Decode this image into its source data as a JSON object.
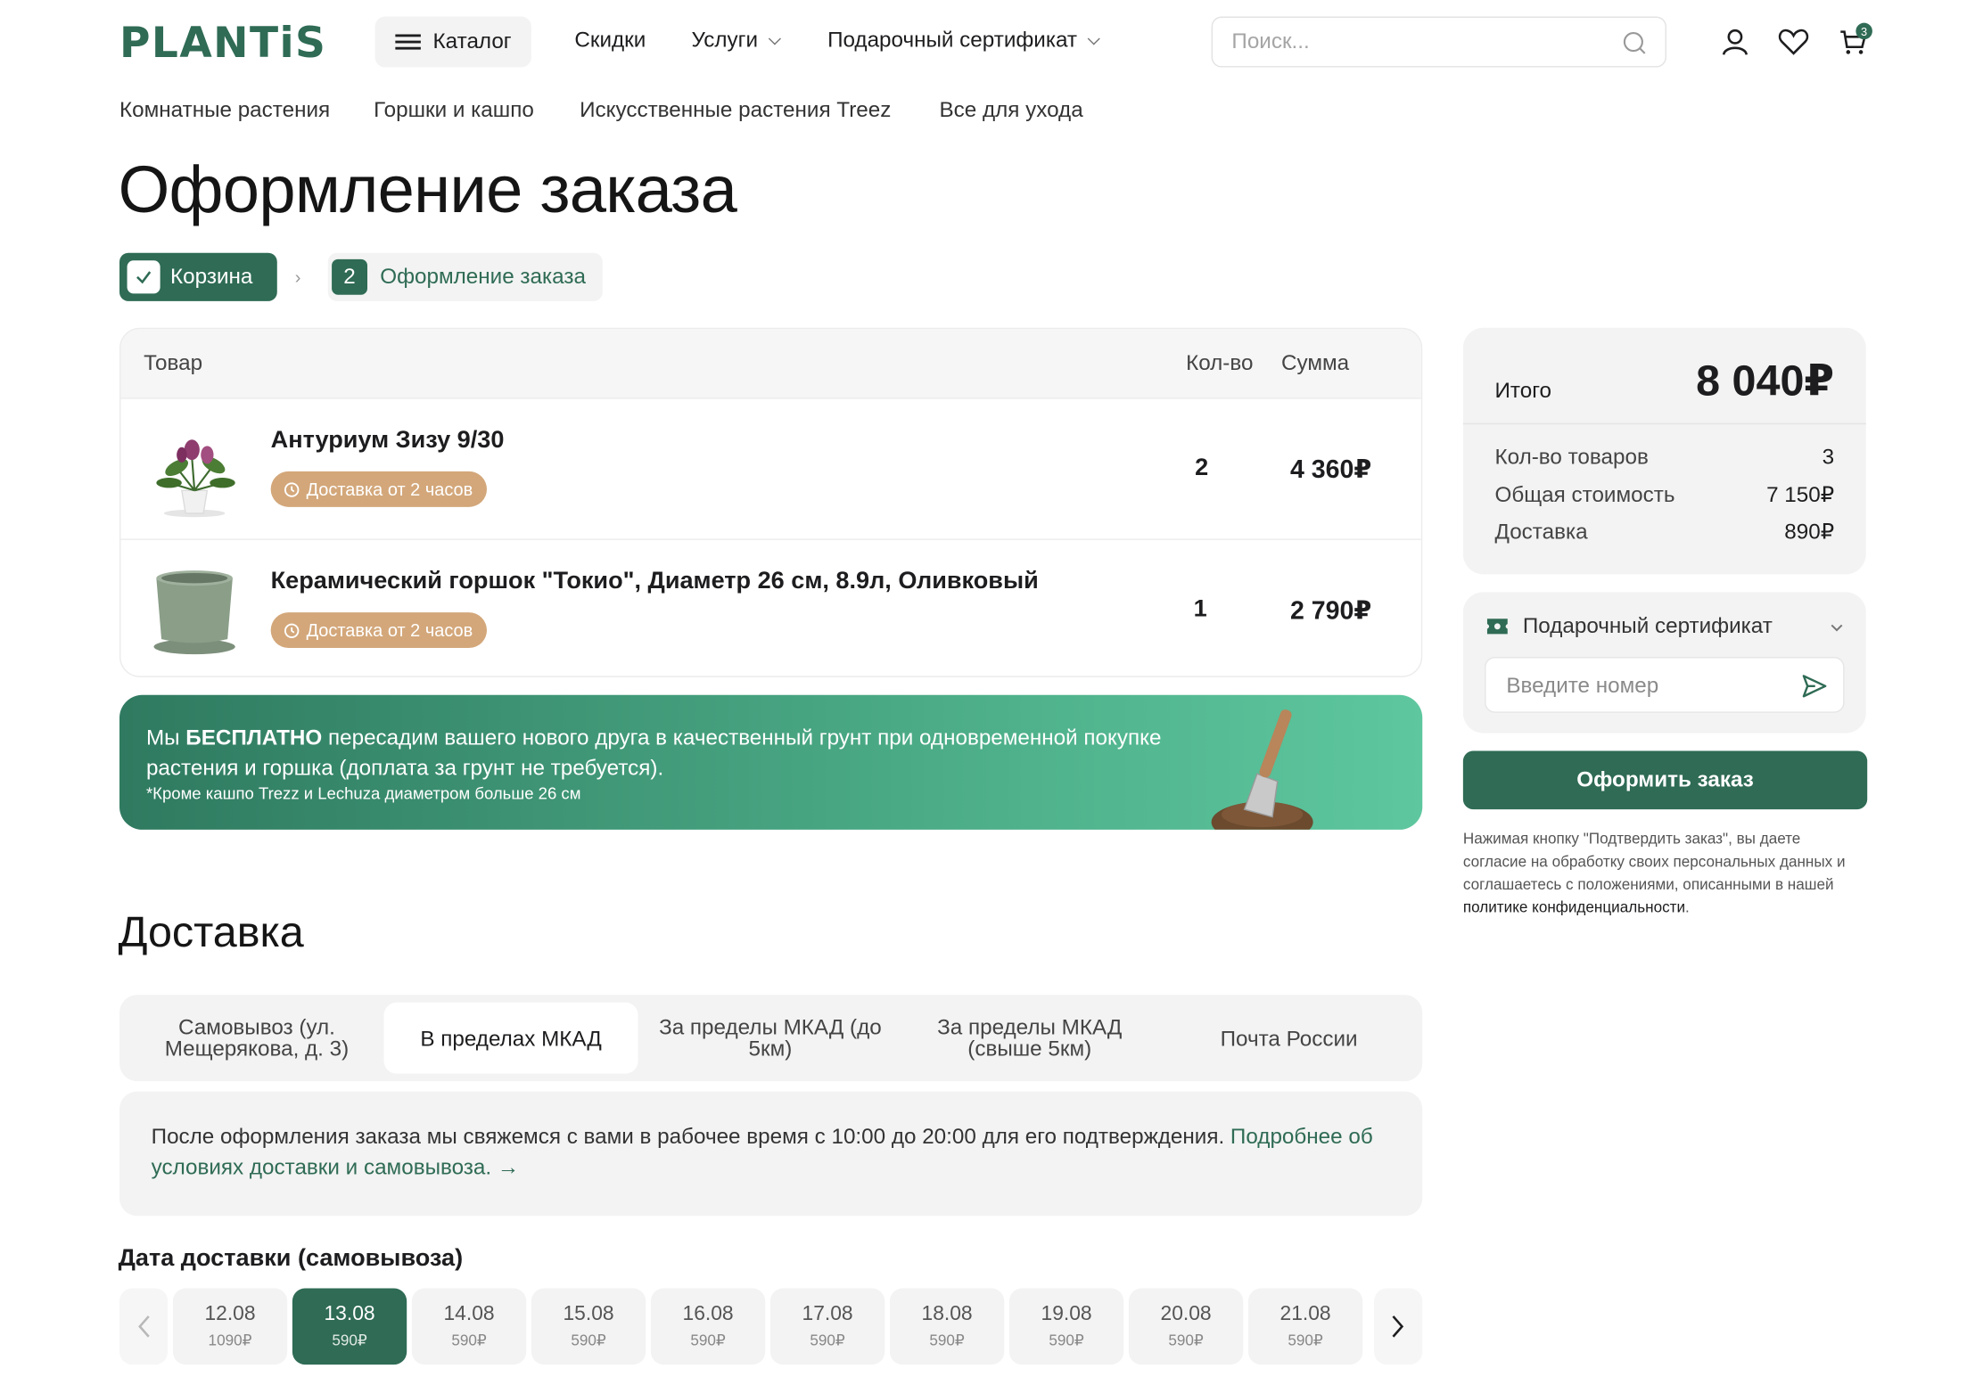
{
  "brand": {
    "logo": "PLANTiS",
    "accent": "#2f6b55"
  },
  "header": {
    "catalog": "Каталог",
    "nav": [
      {
        "label": "Скидки"
      },
      {
        "label": "Услуги"
      },
      {
        "label": "Подарочный сертификат"
      }
    ],
    "search_placeholder": "Поиск...",
    "cart_count": "3",
    "icons": [
      "search-icon",
      "user-icon",
      "heart-icon",
      "cart-icon"
    ]
  },
  "subnav": [
    "Комнатные растения",
    "Горшки и кашпо",
    "Искусственные растения Treez",
    "Все для ухода"
  ],
  "page": {
    "title": "Оформление заказа",
    "steps": [
      {
        "label": "Корзина",
        "state": "done"
      },
      {
        "num": "2",
        "label": "Оформление заказа",
        "state": "current"
      }
    ]
  },
  "cart": {
    "headers": {
      "product": "Товар",
      "qty": "Кол-во",
      "sum": "Сумма"
    },
    "items": [
      {
        "name": "Антуриум Зизу 9/30",
        "badge": "Доставка от 2 часов",
        "qty": "2",
        "sum": "4 360₽"
      },
      {
        "name": "Керамический горшок \"Токио\", Диаметр 26 см, 8.9л, Оливковый",
        "badge": "Доставка от 2 часов",
        "qty": "1",
        "sum": "2 790₽"
      }
    ]
  },
  "promo": {
    "pre": "Мы ",
    "bold": "БЕСПЛАТНО",
    "post": " пересадим вашего нового друга в качественный грунт при одновременной покупке растения и горшка (доплата за грунт не требуется).",
    "note": "*Кроме кашпо Trezz и Lechuza диаметром больше 26 см"
  },
  "delivery": {
    "title": "Доставка",
    "tabs": [
      {
        "label": "Самовывоз (ул. Мещерякова, д. 3)"
      },
      {
        "label": "В пределах МКАД",
        "active": true
      },
      {
        "label": "За пределы МКАД (до 5км)"
      },
      {
        "label": "За пределы МКАД (свыше 5км)"
      },
      {
        "label": "Почта России"
      }
    ],
    "info": "После оформления заказа мы свяжемся с вами в рабочее время с 10:00 до 20:00 для его подтверждения. ",
    "info_link": "Подробнее об условиях доставки и самовывоза.",
    "date_title": "Дата доставки (самовывоза)",
    "dates": [
      {
        "d": "12.08",
        "p": "1090₽"
      },
      {
        "d": "13.08",
        "p": "590₽",
        "active": true
      },
      {
        "d": "14.08",
        "p": "590₽"
      },
      {
        "d": "15.08",
        "p": "590₽"
      },
      {
        "d": "16.08",
        "p": "590₽"
      },
      {
        "d": "17.08",
        "p": "590₽"
      },
      {
        "d": "18.08",
        "p": "590₽"
      },
      {
        "d": "19.08",
        "p": "590₽"
      },
      {
        "d": "20.08",
        "p": "590₽"
      },
      {
        "d": "21.08",
        "p": "590₽"
      }
    ]
  },
  "summary": {
    "total_label": "Итого",
    "total": "8 040₽",
    "rows": [
      {
        "label": "Кол-во товаров",
        "value": "3"
      },
      {
        "label": "Общая стоимость",
        "value": "7 150₽"
      },
      {
        "label": "Доставка",
        "value": "890₽"
      }
    ]
  },
  "gift": {
    "label": "Подарочный сертификат",
    "placeholder": "Введите номер"
  },
  "order": {
    "button": "Оформить заказ",
    "legal": "Нажимая кнопку \"Подтвердить заказ\", вы даете согласие на обработку своих персональных данных и соглашаетесь с положениями, описанными в нашей ",
    "legal_link": "политике конфиденциальности",
    "legal_end": "."
  }
}
